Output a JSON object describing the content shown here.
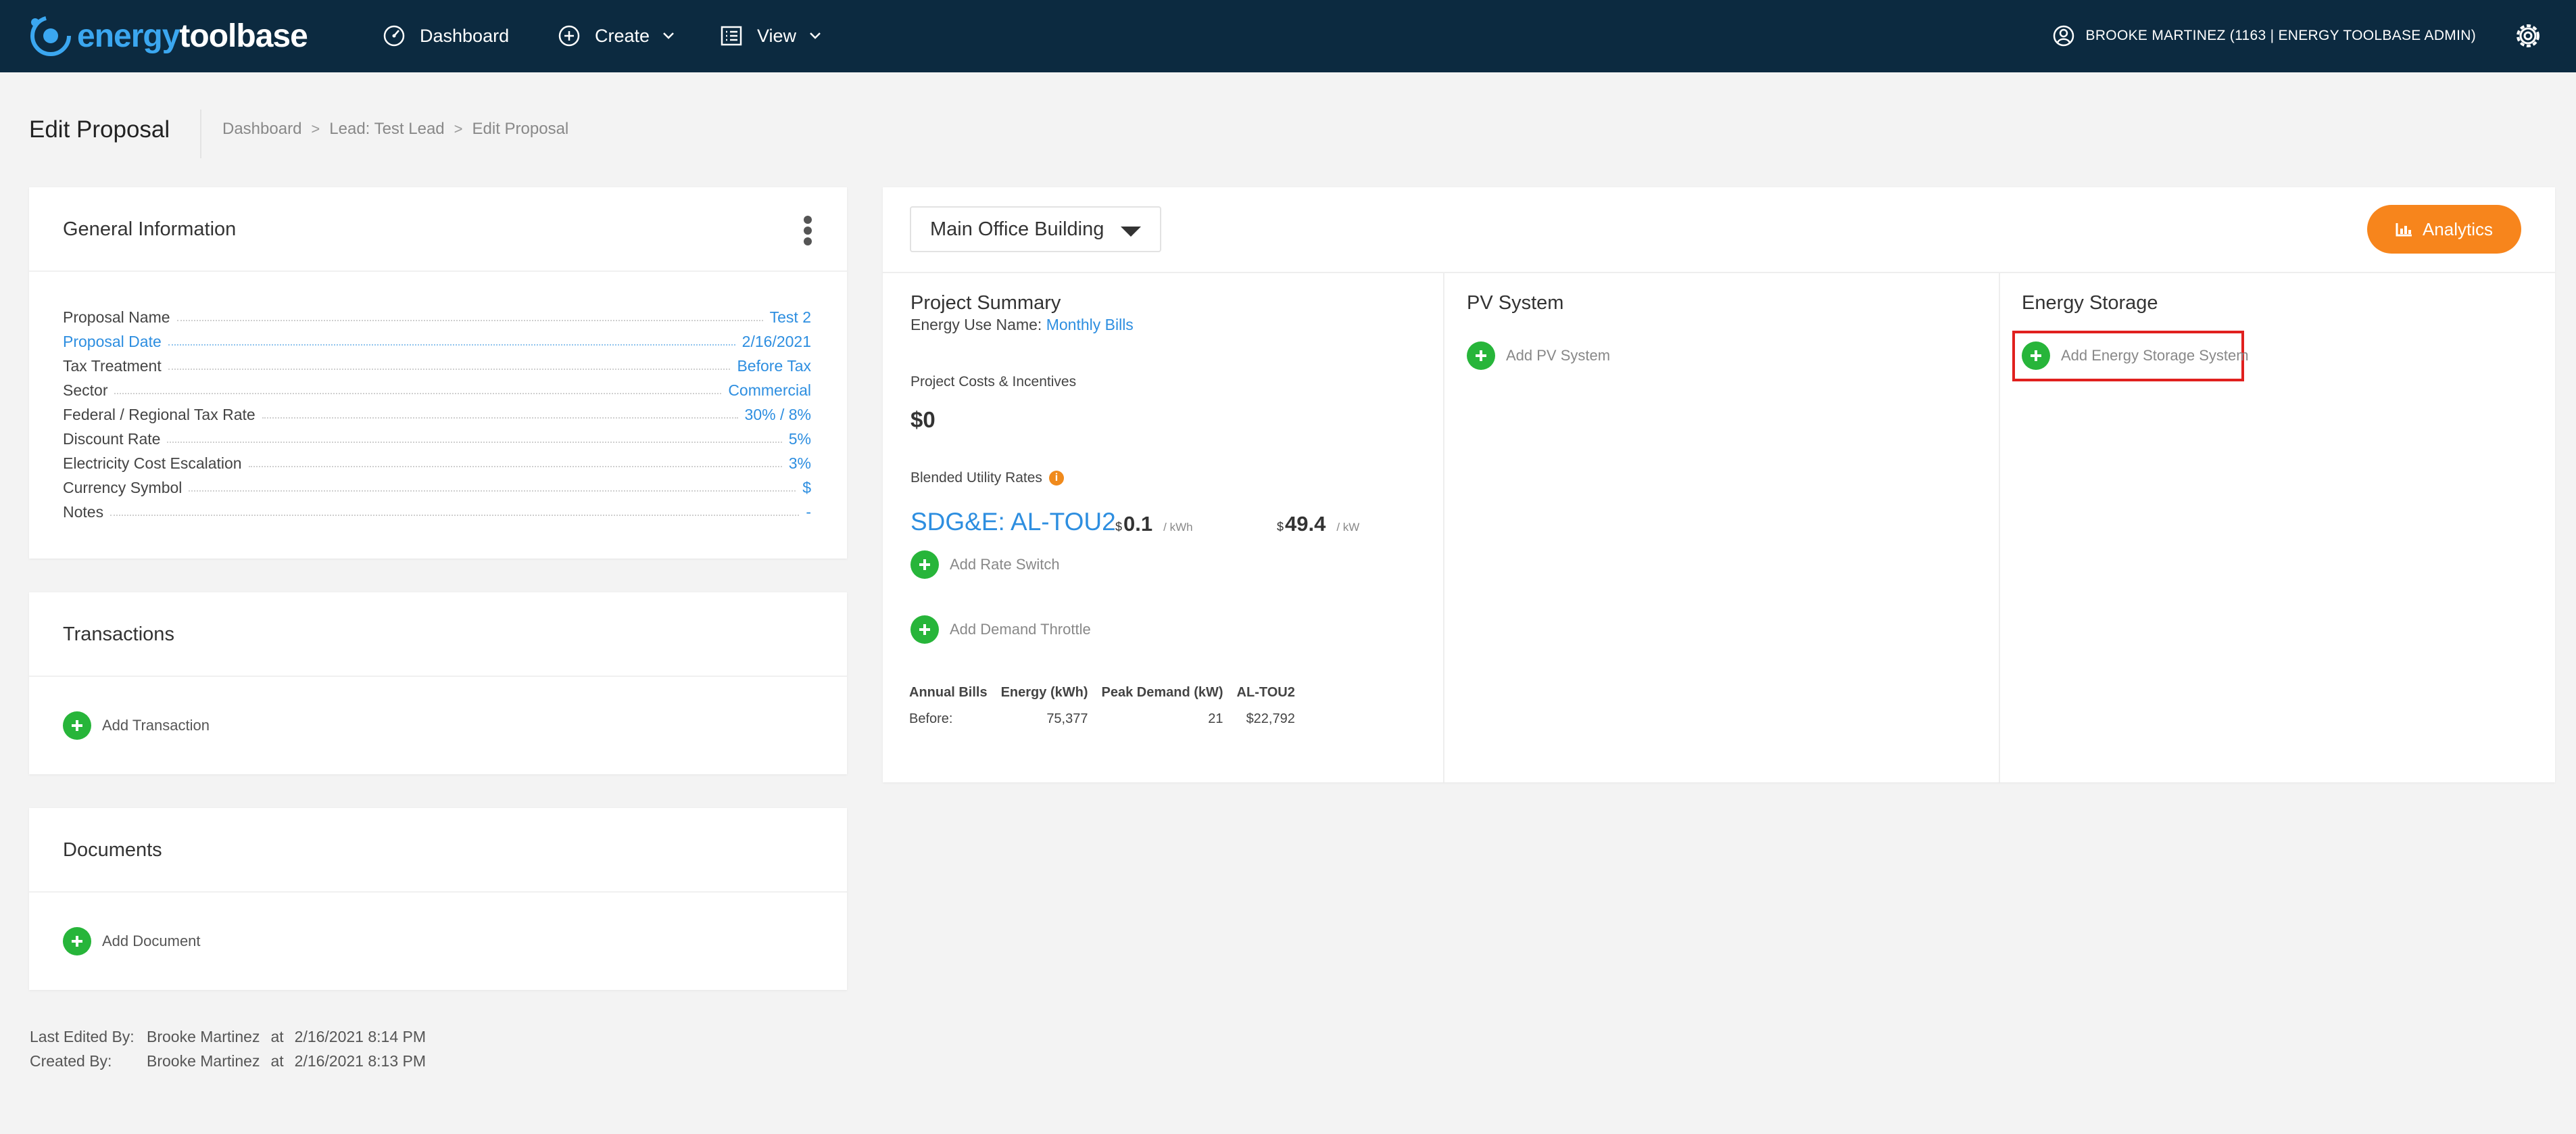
{
  "nav": {
    "logo_part1": "energy",
    "logo_part2": "toolbase",
    "dashboard": "Dashboard",
    "create": "Create",
    "view": "View",
    "user": "BROOKE MARTINEZ (1163 | ENERGY TOOLBASE ADMIN)"
  },
  "header": {
    "title": "Edit Proposal",
    "breadcrumb": [
      "Dashboard",
      "Lead: Test Lead",
      "Edit Proposal"
    ]
  },
  "general": {
    "title": "General Information",
    "rows": [
      {
        "label": "Proposal Name",
        "value": "Test 2"
      },
      {
        "label": "Proposal Date",
        "value": "2/16/2021"
      },
      {
        "label": "Tax Treatment",
        "value": "Before Tax"
      },
      {
        "label": "Sector",
        "value": "Commercial"
      },
      {
        "label": "Federal / Regional Tax Rate",
        "value": "30% / 8%"
      },
      {
        "label": "Discount Rate",
        "value": "5%"
      },
      {
        "label": "Electricity Cost Escalation",
        "value": "3%"
      },
      {
        "label": "Currency Symbol",
        "value": "$"
      },
      {
        "label": "Notes",
        "value": "-"
      }
    ]
  },
  "transactions": {
    "title": "Transactions",
    "add": "Add Transaction"
  },
  "documents": {
    "title": "Documents",
    "add": "Add Document"
  },
  "meta": {
    "edited_label": "Last Edited By:",
    "edited_by": "Brooke Martinez",
    "at": "at",
    "edited_at": "2/16/2021 8:14 PM",
    "created_label": "Created By:",
    "created_by": "Brooke Martinez",
    "created_at": "2/16/2021 8:13 PM"
  },
  "main": {
    "building": "Main Office Building",
    "analytics": "Analytics",
    "summary": {
      "title": "Project Summary",
      "energy_use_label": "Energy Use Name:",
      "energy_use_value": "Monthly Bills",
      "costs_label": "Project Costs & Incentives",
      "costs_value": "$0",
      "blended_label": "Blended Utility Rates",
      "info_icon": "i",
      "rate_name": "SDG&E: AL-TOU2",
      "energy_cur": "$",
      "energy_rate": "0.1",
      "energy_unit": "/ kWh",
      "demand_cur": "$",
      "demand_rate": "49.4",
      "demand_unit": "/ kW",
      "add_rate_switch": "Add Rate Switch",
      "add_demand_throttle": "Add Demand Throttle",
      "bills": {
        "headers": [
          "Annual Bills",
          "Energy (kWh)",
          "Peak Demand (kW)",
          "AL-TOU2"
        ],
        "row": [
          "Before:",
          "75,377",
          "21",
          "$22,792"
        ]
      }
    },
    "pv": {
      "title": "PV System",
      "add": "Add PV System"
    },
    "storage": {
      "title": "Energy Storage",
      "add": "Add Energy Storage System"
    }
  },
  "colors": {
    "nav_bg": "#0c2a40",
    "accent_blue": "#2d8ee0",
    "add_green": "#27b53a",
    "analytics_orange": "#f7851c",
    "highlight_red": "#e0201e"
  }
}
